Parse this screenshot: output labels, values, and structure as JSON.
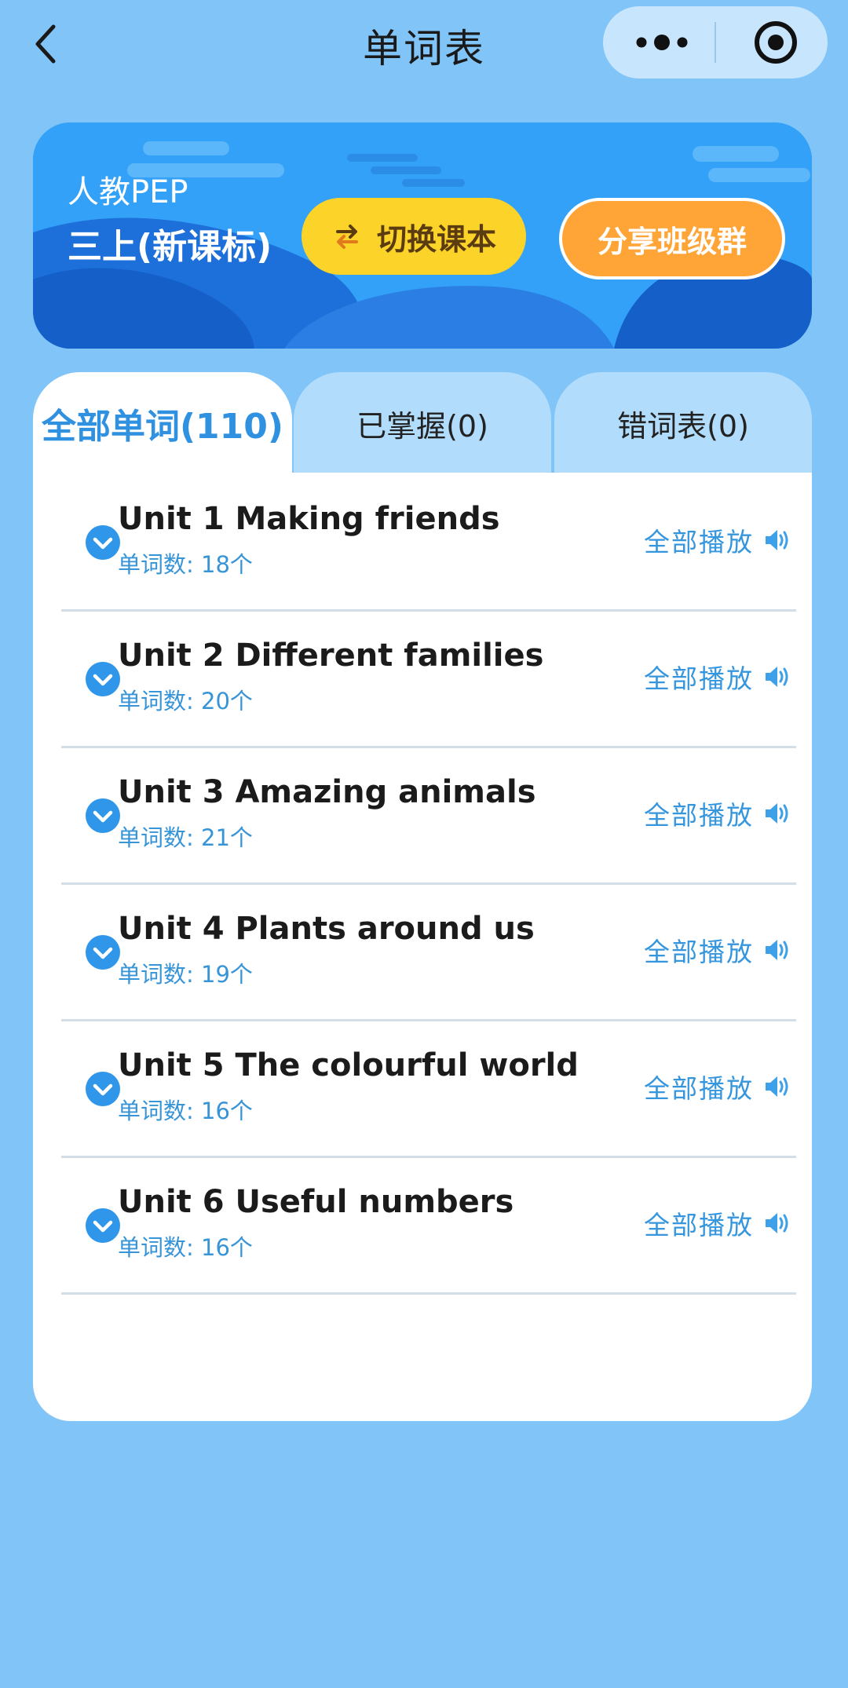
{
  "nav": {
    "title": "单词表"
  },
  "banner": {
    "publisher": "人教PEP",
    "grade": "三上(新课标)",
    "switch_label": "切换课本",
    "share_label": "分享班级群"
  },
  "tabs": [
    {
      "label": "全部单词(110)",
      "active": true
    },
    {
      "label": "已掌握(0)",
      "active": false
    },
    {
      "label": "错词表(0)",
      "active": false
    }
  ],
  "units": [
    {
      "title": "Unit 1 Making friends",
      "count": "单词数: 18个",
      "play_label": "全部播放"
    },
    {
      "title": "Unit 2 Different families",
      "count": "单词数: 20个",
      "play_label": "全部播放"
    },
    {
      "title": "Unit 3 Amazing animals",
      "count": "单词数: 21个",
      "play_label": "全部播放"
    },
    {
      "title": "Unit 4 Plants around us",
      "count": "单词数: 19个",
      "play_label": "全部播放"
    },
    {
      "title": "Unit 5 The colourful world",
      "count": "单词数: 16个",
      "play_label": "全部播放"
    },
    {
      "title": "Unit 6 Useful numbers",
      "count": "单词数: 16个",
      "play_label": "全部播放"
    }
  ],
  "colors": {
    "page_background": "#81c4f8",
    "accent_blue": "#2f91e0",
    "switch_button": "#fbd329",
    "share_button": "#ffa437"
  },
  "icons": {
    "back": "chevron-left-icon",
    "more": "more-dots-icon",
    "close": "target-close-icon",
    "switch": "swap-arrows-icon",
    "row_expand": "chevron-down-circle-icon",
    "play": "speaker-icon"
  }
}
